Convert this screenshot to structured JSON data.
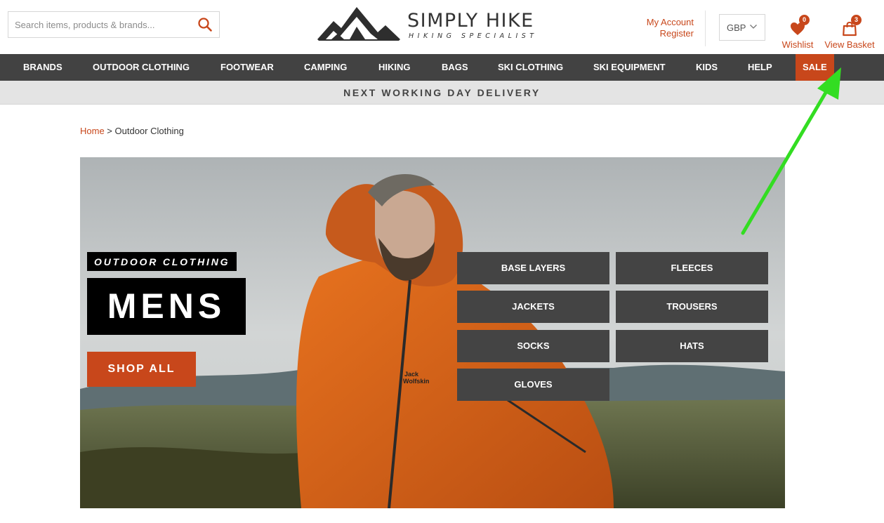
{
  "search": {
    "placeholder": "Search items, products & brands..."
  },
  "logo": {
    "name": "SIMPLY HIKE",
    "tagline": "HIKING SPECIALIST"
  },
  "account": {
    "my_account": "My Account",
    "register": "Register"
  },
  "currency": {
    "selected": "GBP"
  },
  "wishlist": {
    "label": "Wishlist",
    "count": "0"
  },
  "basket": {
    "label": "View Basket",
    "count": "3"
  },
  "nav": {
    "items": [
      "BRANDS",
      "OUTDOOR CLOTHING",
      "FOOTWEAR",
      "CAMPING",
      "HIKING",
      "BAGS",
      "SKI CLOTHING",
      "SKI EQUIPMENT",
      "KIDS",
      "HELP",
      "SALE"
    ]
  },
  "banner": {
    "text": "NEXT WORKING DAY DELIVERY"
  },
  "breadcrumb": {
    "home": "Home",
    "separator": " > ",
    "current": "Outdoor Clothing"
  },
  "hero": {
    "tag": "OUTDOOR CLOTHING",
    "title": "MENS",
    "cta": "SHOP ALL",
    "jacket_brand_line1": "Jack",
    "jacket_brand_line2": "Wolfskin",
    "categories": [
      "BASE LAYERS",
      "FLEECES",
      "JACKETS",
      "TROUSERS",
      "SOCKS",
      "HATS",
      "GLOVES"
    ]
  },
  "colors": {
    "accent": "#c8471b",
    "nav_bg": "#424242",
    "arrow": "#33dd22"
  }
}
